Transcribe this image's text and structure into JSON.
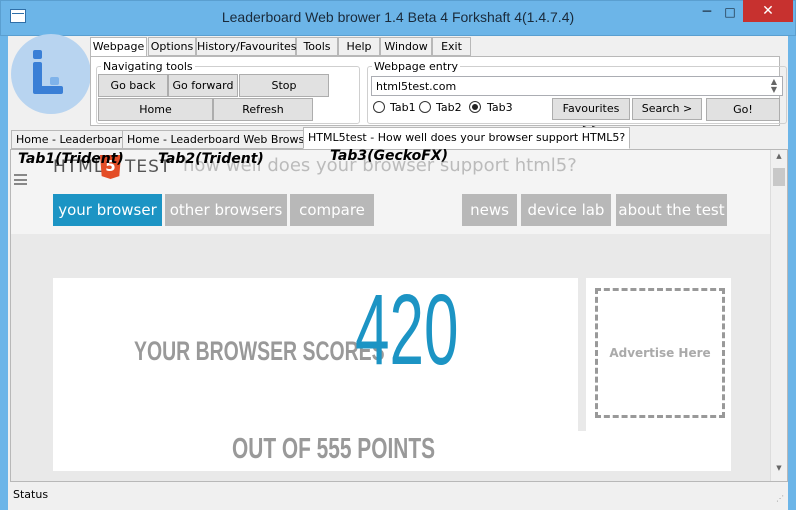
{
  "window": {
    "title": "Leaderboard Web brower 1.4 Beta 4 Forkshaft 4(1.4.7.4)",
    "minimize": "─",
    "maximize": "□",
    "close": "✕"
  },
  "menu_tabs": [
    "Webpage",
    "Options",
    "History/Favourites",
    "Tools",
    "Help",
    "Window",
    "Exit"
  ],
  "navigating_tools": {
    "legend": "Navigating tools",
    "back": "Go back",
    "forward": "Go forward",
    "stop": "Stop",
    "home": "Home",
    "refresh": "Refresh"
  },
  "webpage_entry": {
    "legend": "Webpage entry",
    "url": "html5test.com",
    "tab1": "Tab1",
    "tab2": "Tab2",
    "tab3": "Tab3",
    "selected_tab": "Tab3",
    "favourites": "Favourites >>",
    "search": "Search >",
    "go": "Go!"
  },
  "browser_tabs": [
    "Home - Leaderboard",
    "Home - Leaderboard Web Browser",
    "HTML5test - How well does your browser support HTML5?"
  ],
  "annotations": {
    "tab1": "Tab1(Trident)",
    "tab2": "Tab2(Trident)",
    "tab3": "Tab3(GeckoFX)"
  },
  "site": {
    "logo_html": "HTML",
    "logo_five": "5",
    "logo_test": "TEST",
    "tagline": "how well does your browser support html5?",
    "nav_left": [
      "your browser",
      "other browsers",
      "compare"
    ],
    "nav_right": [
      "news",
      "device lab",
      "about the test"
    ],
    "score_label": "YOUR BROWSER SCORES",
    "score": "420",
    "out_of": "OUT OF 555 POINTS",
    "advertise": "Advertise Here",
    "accent": "#1c94c4"
  },
  "status": "Status"
}
